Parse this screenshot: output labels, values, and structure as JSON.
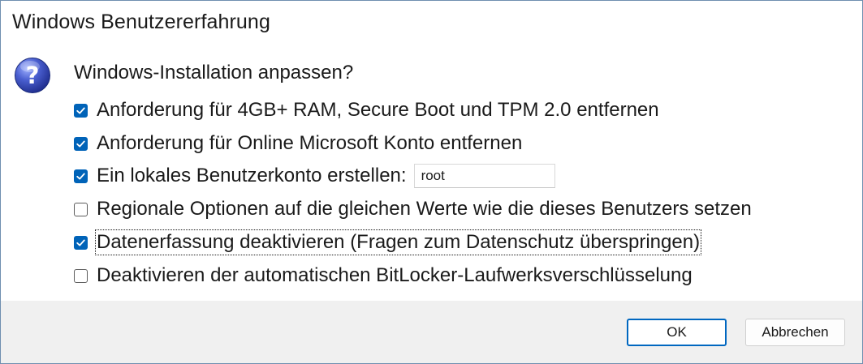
{
  "window": {
    "title": "Windows Benutzererfahrung"
  },
  "dialog": {
    "question": "Windows-Installation anpassen?",
    "icon": "question-icon",
    "options": [
      {
        "label": "Anforderung für 4GB+ RAM, Secure Boot und TPM 2.0 entfernen",
        "checked": true
      },
      {
        "label": "Anforderung für Online Microsoft Konto entfernen",
        "checked": true
      },
      {
        "label": "Ein lokales Benutzerkonto erstellen:",
        "checked": true
      },
      {
        "label": "Regionale Optionen auf die gleichen Werte wie die dieses Benutzers setzen",
        "checked": false
      },
      {
        "label": "Datenerfassung deaktivieren (Fragen zum Datenschutz überspringen)",
        "checked": true,
        "focused": true
      },
      {
        "label": "Deaktivieren der automatischen BitLocker-Laufwerksverschlüsselung",
        "checked": false
      }
    ],
    "username_value": "root"
  },
  "buttons": {
    "ok_label": "OK",
    "cancel_label": "Abbrechen"
  },
  "colors": {
    "accent": "#0063b8",
    "footer_bg": "#f0f0f0",
    "window_border": "#6f8fb0"
  }
}
